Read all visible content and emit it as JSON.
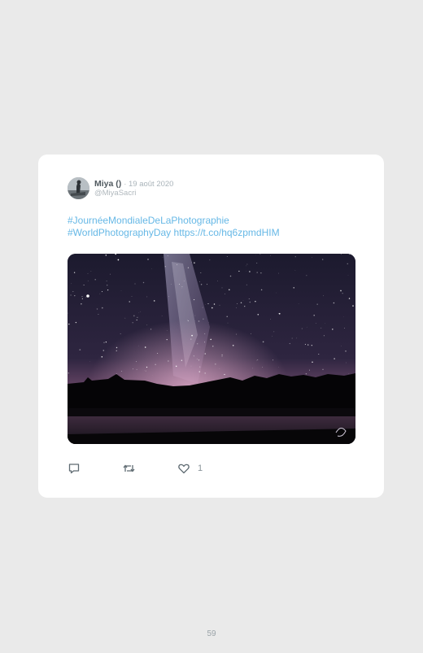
{
  "tweet": {
    "author_name": "Miya ()",
    "date": "· 19 août 2020",
    "handle": "@MiyaSacri",
    "text_line1": "#JournéeMondialeDeLaPhotographie",
    "text_line2": "#WorldPhotographyDay https://t.co/hq6zpmdHIM",
    "likes": "1"
  },
  "icons": {
    "reply": "reply-icon",
    "retweet": "retweet-icon",
    "like": "heart-icon",
    "avatar": "avatar",
    "photo": "milky-way-photo"
  },
  "page_number": "59",
  "colors": {
    "background": "#eaeaea",
    "card": "#ffffff",
    "link": "#66b8e6",
    "icon": "#5f6b72"
  }
}
